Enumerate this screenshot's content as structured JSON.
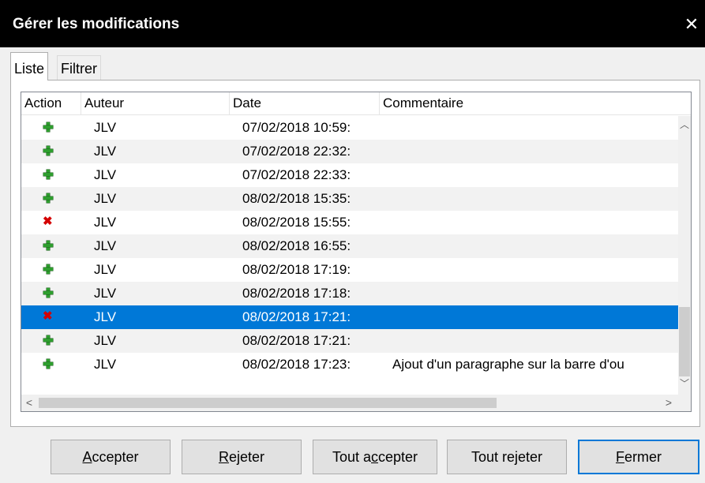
{
  "window": {
    "title": "Gérer les modifications",
    "close_glyph": "✕"
  },
  "tabs": [
    {
      "label": "Liste",
      "active": true
    },
    {
      "label": "Filtrer",
      "active": false
    }
  ],
  "list": {
    "columns": [
      "Action",
      "Auteur",
      "Date",
      "Commentaire"
    ],
    "rows": [
      {
        "action": "insertion",
        "icon": "green-plus-icon",
        "author": "JLV",
        "date": "07/02/2018 10:59:",
        "comment": ""
      },
      {
        "action": "insertion",
        "icon": "green-plus-icon",
        "author": "JLV",
        "date": "07/02/2018 22:32:",
        "comment": ""
      },
      {
        "action": "insertion",
        "icon": "green-plus-icon",
        "author": "JLV",
        "date": "07/02/2018 22:33:",
        "comment": ""
      },
      {
        "action": "insertion",
        "icon": "green-plus-icon",
        "author": "JLV",
        "date": "08/02/2018 15:35:",
        "comment": ""
      },
      {
        "action": "deletion",
        "icon": "red-cross-icon",
        "author": "JLV",
        "date": "08/02/2018 15:55:",
        "comment": ""
      },
      {
        "action": "insertion",
        "icon": "green-plus-icon",
        "author": "JLV",
        "date": "08/02/2018 16:55:",
        "comment": ""
      },
      {
        "action": "insertion",
        "icon": "green-plus-icon",
        "author": "JLV",
        "date": "08/02/2018 17:19:",
        "comment": ""
      },
      {
        "action": "insertion",
        "icon": "green-plus-icon",
        "author": "JLV",
        "date": "08/02/2018 17:18:",
        "comment": ""
      },
      {
        "action": "deletion",
        "icon": "red-cross-icon",
        "author": "JLV",
        "date": "08/02/2018 17:21:",
        "comment": "",
        "selected": true
      },
      {
        "action": "insertion",
        "icon": "green-plus-icon",
        "author": "JLV",
        "date": "08/02/2018 17:21:",
        "comment": ""
      },
      {
        "action": "insertion",
        "icon": "green-plus-icon",
        "author": "JLV",
        "date": "08/02/2018 17:23:",
        "comment": "Ajout d'un paragraphe sur la barre d'ou"
      }
    ]
  },
  "buttons": {
    "accept": {
      "mnemonic": "A",
      "rest": "ccepter"
    },
    "reject": {
      "mnemonic": "R",
      "rest": "ejeter"
    },
    "accept_all": {
      "pre": "Tout a",
      "mnemonic": "c",
      "post": "cepter"
    },
    "reject_all": {
      "pre": "Tout re",
      "mnemonic": "j",
      "post": "eter"
    },
    "close": {
      "mnemonic": "F",
      "rest": "ermer"
    }
  },
  "colors": {
    "selection": "#0078d7",
    "insert": "#2e9e2e",
    "delete": "#d40000"
  }
}
